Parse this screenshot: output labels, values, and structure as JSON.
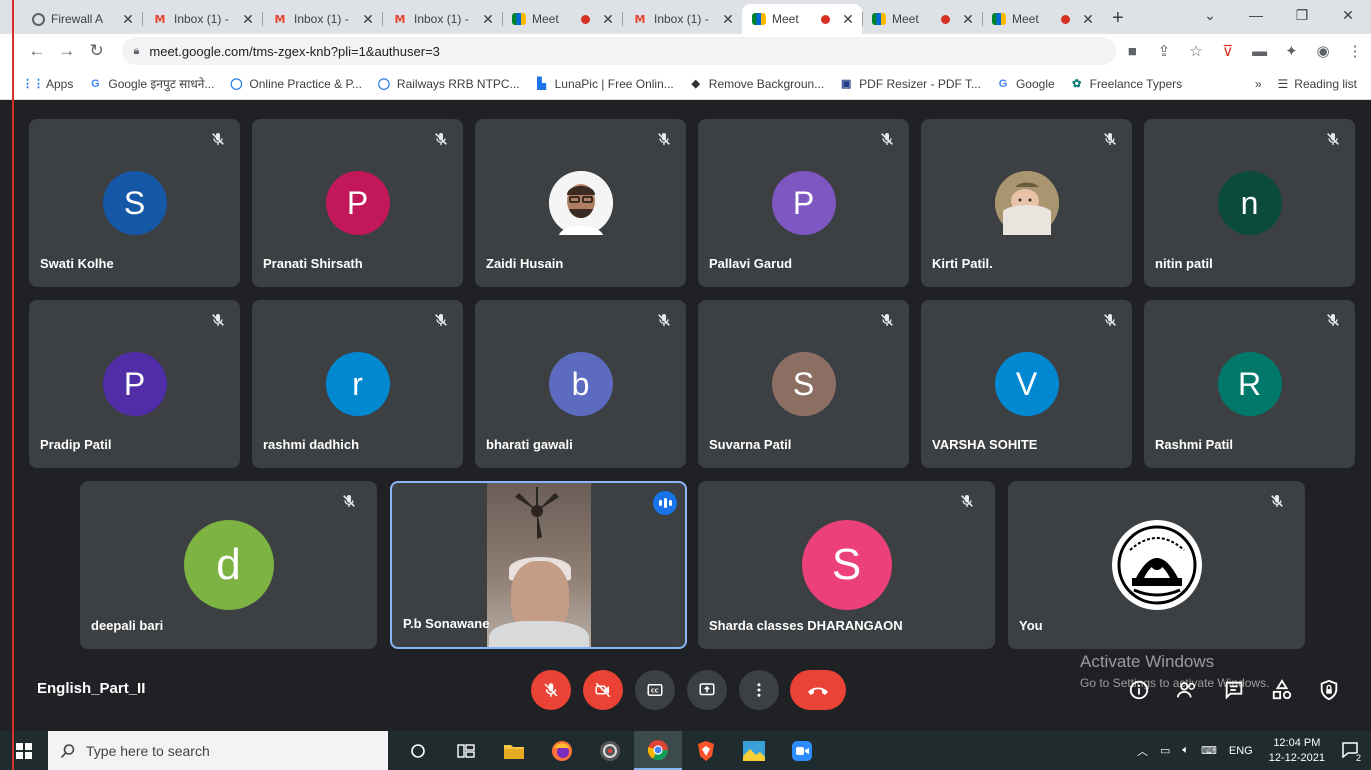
{
  "browser": {
    "tabs": [
      {
        "title": "Firewall A",
        "icon": "firewall-icon",
        "active": false,
        "recording": false
      },
      {
        "title": "Inbox (1) -",
        "icon": "gmail-icon",
        "active": false,
        "recording": false
      },
      {
        "title": "Inbox (1) -",
        "icon": "gmail-icon",
        "active": false,
        "recording": false
      },
      {
        "title": "Inbox (1) -",
        "icon": "gmail-icon",
        "active": false,
        "recording": false
      },
      {
        "title": "Meet",
        "icon": "meet-icon",
        "active": false,
        "recording": true
      },
      {
        "title": "Inbox (1) -",
        "icon": "gmail-icon",
        "active": false,
        "recording": false
      },
      {
        "title": "Meet",
        "icon": "meet-icon",
        "active": true,
        "recording": true
      },
      {
        "title": "Meet",
        "icon": "meet-icon",
        "active": false,
        "recording": true
      },
      {
        "title": "Meet",
        "icon": "meet-icon",
        "active": false,
        "recording": true
      }
    ],
    "url": "meet.google.com/tms-zgex-knb?pli=1&authuser=3",
    "bookmarks": [
      {
        "label": "Apps",
        "icon": "apps-grid-icon"
      },
      {
        "label": "Google इनपुट साधने...",
        "icon": "google-icon"
      },
      {
        "label": "Online Practice & P...",
        "icon": "globe-icon"
      },
      {
        "label": "Railways RRB NTPC...",
        "icon": "globe-icon"
      },
      {
        "label": "LunaPic | Free Onlin...",
        "icon": "lunapic-icon"
      },
      {
        "label": "Remove Backgroun...",
        "icon": "removebg-icon"
      },
      {
        "label": "PDF Resizer - PDF T...",
        "icon": "pdf-icon"
      },
      {
        "label": "Google",
        "icon": "google-icon"
      },
      {
        "label": "Freelance Typers",
        "icon": "freelance-icon"
      }
    ],
    "reading_list": "Reading list",
    "overflow": "»"
  },
  "meet": {
    "participants": [
      {
        "name": "Swati Kolhe",
        "initial": "S",
        "color": "#1558a7",
        "muted": true
      },
      {
        "name": "Pranati Shirsath",
        "initial": "P",
        "color": "#c2185b",
        "muted": true
      },
      {
        "name": "Zaidi Husain",
        "initial": "",
        "photo": "person-photo",
        "muted": true
      },
      {
        "name": "Pallavi Garud",
        "initial": "P",
        "color": "#7e57c2",
        "muted": true
      },
      {
        "name": "Kirti Patil.",
        "initial": "",
        "photo": "baby-photo",
        "muted": true
      },
      {
        "name": "nitin patil",
        "initial": "n",
        "color": "#0b4b3c",
        "muted": true
      },
      {
        "name": "Pradip Patil",
        "initial": "P",
        "color": "#512da8",
        "muted": true
      },
      {
        "name": "rashmi dadhich",
        "initial": "r",
        "color": "#0288d1",
        "muted": true
      },
      {
        "name": "bharati gawali",
        "initial": "b",
        "color": "#5c6bc0",
        "muted": true
      },
      {
        "name": "Suvarna Patil",
        "initial": "S",
        "color": "#8d6e63",
        "muted": true
      },
      {
        "name": "VARSHA SOHITE",
        "initial": "V",
        "color": "#0288d1",
        "muted": true
      },
      {
        "name": "Rashmi Patil",
        "initial": "R",
        "color": "#00796b",
        "muted": true
      },
      {
        "name": "deepali bari",
        "initial": "d",
        "color": "#7cb342",
        "muted": true
      },
      {
        "name": "P.b Sonawane",
        "initial": "",
        "video": true,
        "speaking": true,
        "muted": false
      },
      {
        "name": "Sharda classes DHARANGAON",
        "initial": "S",
        "color": "#ec407a",
        "muted": true
      },
      {
        "name": "You",
        "initial": "",
        "photo": "emblem-logo",
        "muted": true
      }
    ],
    "meeting_title": "English_Part_II",
    "controls": [
      "mic-off",
      "camera-off",
      "captions",
      "present-screen",
      "more-options",
      "hang-up"
    ],
    "side_tools": [
      "info",
      "people",
      "chat",
      "activities",
      "host-controls"
    ]
  },
  "watermark": {
    "line1": "Activate Windows",
    "line2": "Go to Settings to activate Windows."
  },
  "taskbar": {
    "search_placeholder": "Type here to search",
    "apps": [
      "cortana-icon",
      "task-view-icon",
      "file-explorer-icon",
      "firefox-icon",
      "media-icon",
      "chrome-icon",
      "brave-icon",
      "photos-icon",
      "zoom-icon"
    ],
    "language": "ENG",
    "time": "12:04 PM",
    "date": "12-12-2021",
    "notifications": "2"
  }
}
